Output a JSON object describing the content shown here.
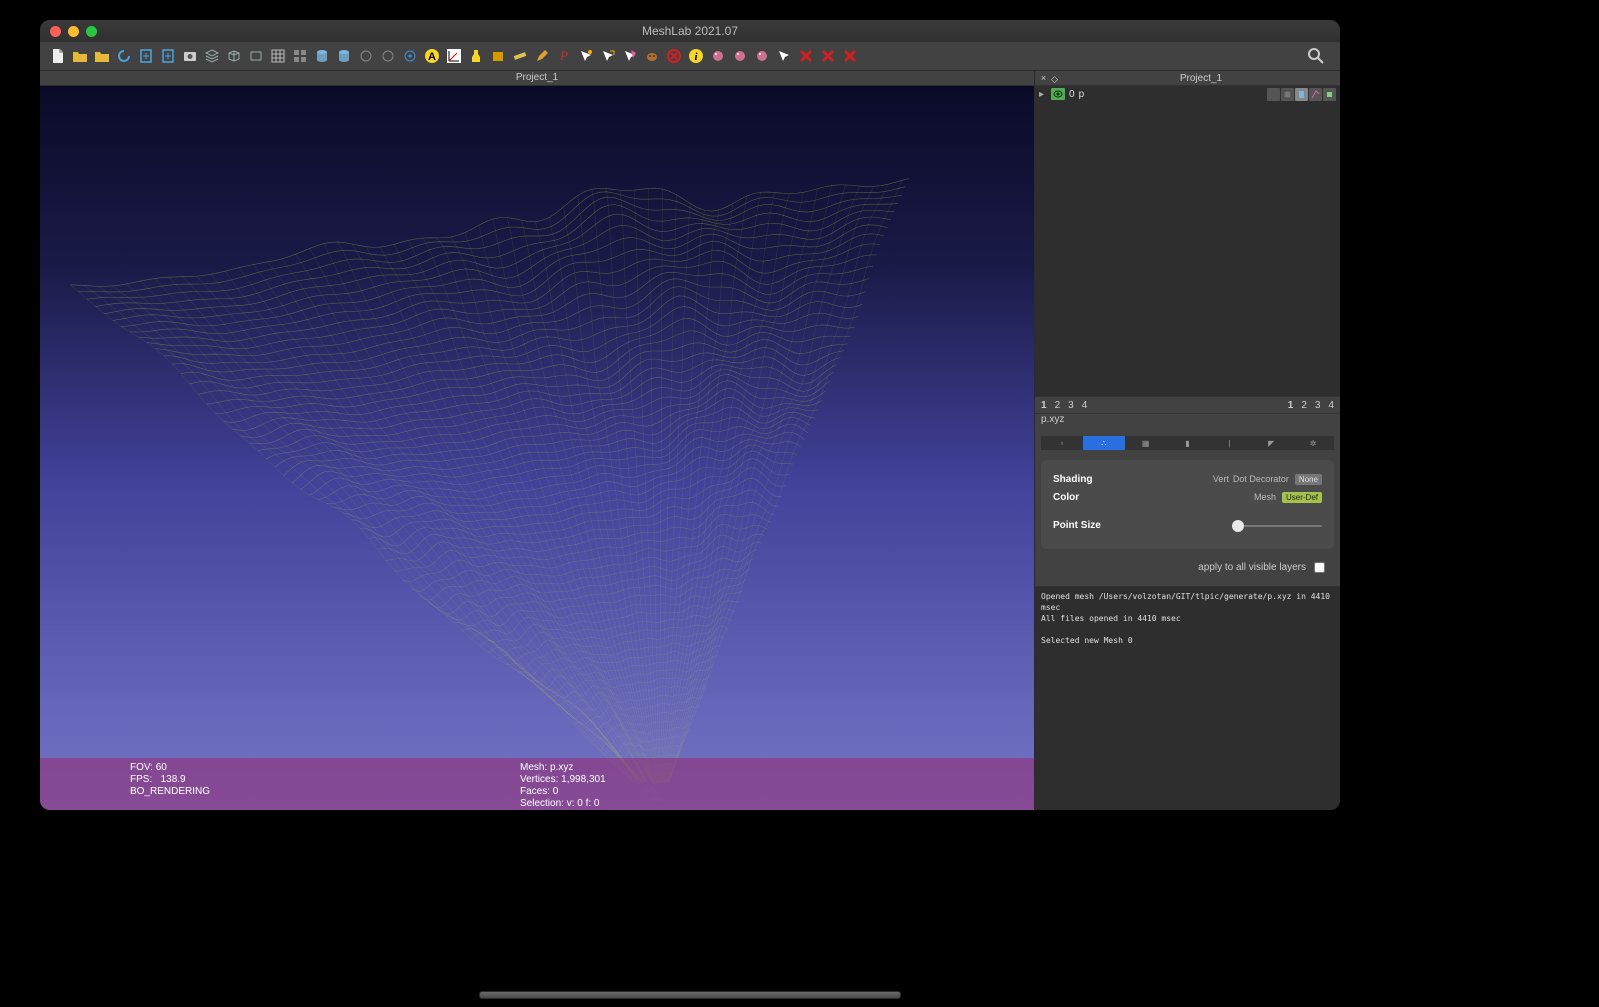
{
  "window": {
    "title": "MeshLab 2021.07"
  },
  "project_tab": "Project_1",
  "side_panel_title": "Project_1",
  "toolbar_icons": [
    "new-file-icon",
    "open-file-icon",
    "open-recent-icon",
    "reload-icon",
    "import-mesh-icon",
    "export-mesh-icon",
    "snapshot-icon",
    "layers-icon",
    "cube-icon",
    "rect-icon",
    "grid-icon",
    "squares-icon",
    "cylinder-solid-icon",
    "cylinder-shade-icon",
    "pick-icon",
    "move-icon",
    "target-icon",
    "letter-a-icon",
    "axes-icon",
    "flashlight-icon",
    "box-icon",
    "ruler-icon",
    "pencil-icon",
    "permanent-icon",
    "select-vert-icon",
    "select-conn-icon",
    "select-face-icon",
    "select-dog-icon",
    "select-x-icon",
    "info-icon",
    "paint-a-icon",
    "paint-b-icon",
    "paint-c-icon",
    "paint-cursor-icon",
    "del-a-icon",
    "del-b-icon",
    "del-c-icon"
  ],
  "icon_colors": {
    "new-file-icon": "#eee",
    "open-file-icon": "#e6b93a",
    "open-recent-icon": "#e6b93a",
    "reload-icon": "#4aa3e0",
    "import-mesh-icon": "#4aa3e0",
    "export-mesh-icon": "#4aa3e0",
    "snapshot-icon": "#ccc",
    "layers-icon": "#9aa",
    "cube-icon": "#9aa",
    "rect-icon": "#9aa",
    "grid-icon": "#bbb",
    "squares-icon": "#888",
    "cylinder-solid-icon": "#7ab6e0",
    "cylinder-shade-icon": "#7ab6e0",
    "pick-icon": "#888",
    "move-icon": "#888",
    "target-icon": "#3a90e0",
    "letter-a-icon": "#f7d628",
    "axes-icon": "#fff",
    "flashlight-icon": "#f7d628",
    "box-icon": "#d59a00",
    "ruler-icon": "#e0c050",
    "pencil-icon": "#e0a030",
    "permanent-icon": "#c03030",
    "select-vert-icon": "#fff",
    "select-conn-icon": "#fff",
    "select-face-icon": "#e85caa",
    "select-dog-icon": "#b07030",
    "select-x-icon": "#d02020",
    "info-icon": "#f7d628",
    "paint-a-icon": "#d07090",
    "paint-b-icon": "#d07090",
    "paint-c-icon": "#d07090",
    "paint-cursor-icon": "#fff",
    "del-a-icon": "#d02020",
    "del-b-icon": "#d02020",
    "del-c-icon": "#d02020"
  },
  "layer": {
    "index": "0",
    "name": "p"
  },
  "numbar_left": [
    "1",
    "2",
    "3",
    "4"
  ],
  "numbar_right": [
    "1",
    "2",
    "3",
    "4"
  ],
  "mesh_label": "p.xyz",
  "render_tabs": [
    {
      "name": "box-tab",
      "icon": "▫"
    },
    {
      "name": "points-tab",
      "icon": "∴"
    },
    {
      "name": "wire-tab",
      "icon": "▦"
    },
    {
      "name": "fill-tab",
      "icon": "▮"
    },
    {
      "name": "sel-tab",
      "icon": "|"
    },
    {
      "name": "edge-tab",
      "icon": "◤"
    },
    {
      "name": "normal-tab",
      "icon": "✲"
    }
  ],
  "active_render_tab": 1,
  "options": {
    "shading_label": "Shading",
    "shading_mode_lab": "Vert",
    "shading_dec_lab": "Dot Decorator",
    "shading_dec_val": "None",
    "color_label": "Color",
    "color_mode_lab": "Mesh",
    "color_val": "User-Def",
    "pointsize_label": "Point Size"
  },
  "apply_label": "apply to all visible layers",
  "log_lines": [
    "Opened mesh /Users/volzotan/GIT/tlpic/generate/p.xyz in 4410 msec",
    "All files opened in 4410 msec",
    "",
    "Selected new Mesh 0"
  ],
  "hud": {
    "fov_label": "FOV:",
    "fov": "60",
    "fps_label": "FPS:",
    "fps": "138.9",
    "render_mode": "BO_RENDERING",
    "mesh_label": "Mesh:",
    "mesh": "p.xyz",
    "verts_label": "Vertices:",
    "verts": "1,998,301",
    "faces_label": "Faces:",
    "faces": "0",
    "sel_label": "Selection:",
    "sel": "v: 0 f: 0"
  }
}
